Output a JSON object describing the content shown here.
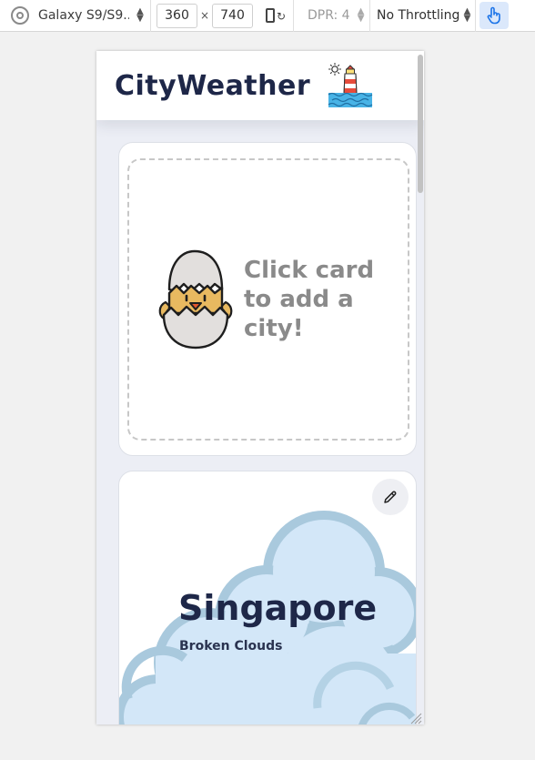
{
  "devtools": {
    "device_name": "Galaxy S9/S9...",
    "width": "360",
    "times": "×",
    "height": "740",
    "dpr": "DPR: 4",
    "throttling": "No Throttling"
  },
  "app": {
    "title": "CityWeather",
    "logo_icon": "lighthouse-icon"
  },
  "add_card": {
    "text": "Click card to add a city!",
    "icon": "hatching-chick-icon"
  },
  "city_card": {
    "name": "Singapore",
    "description": "Broken Clouds",
    "background": "broken-clouds-illustration",
    "edit_icon": "pencil-icon"
  },
  "colors": {
    "title": "#1e2748",
    "page_bg": "#eceef5",
    "cloud_fill": "#d3e7f8",
    "cloud_outline": "#a9c9dd",
    "accent_blue": "#1a73e8"
  }
}
